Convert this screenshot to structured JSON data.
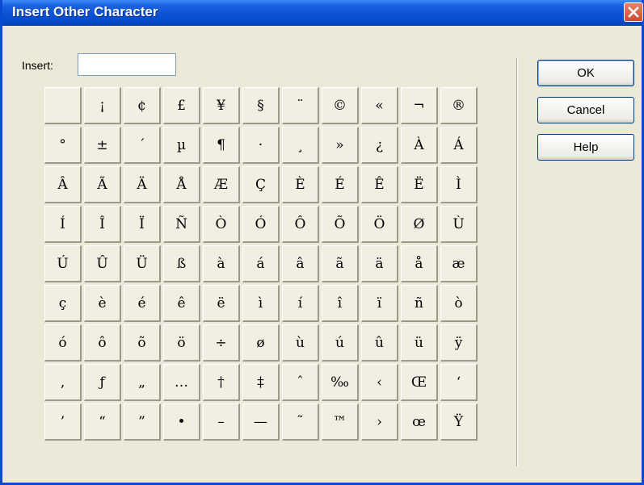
{
  "window": {
    "title": "Insert Other Character"
  },
  "insert": {
    "label": "Insert:",
    "value": ""
  },
  "characters": [
    "",
    "¡",
    "¢",
    "£",
    "¥",
    "§",
    "¨",
    "©",
    "«",
    "¬",
    "®",
    "°",
    "±",
    "´",
    "µ",
    "¶",
    "·",
    "¸",
    "»",
    "¿",
    "À",
    "Á",
    "Â",
    "Ã",
    "Ä",
    "Å",
    "Æ",
    "Ç",
    "È",
    "É",
    "Ê",
    "Ë",
    "Ì",
    "Í",
    "Î",
    "Ï",
    "Ñ",
    "Ò",
    "Ó",
    "Ô",
    "Õ",
    "Ö",
    "Ø",
    "Ù",
    "Ú",
    "Û",
    "Ü",
    "ß",
    "à",
    "á",
    "â",
    "ã",
    "ä",
    "å",
    "æ",
    "ç",
    "è",
    "é",
    "ê",
    "ë",
    "ì",
    "í",
    "î",
    "ï",
    "ñ",
    "ò",
    "ó",
    "ô",
    "õ",
    "ö",
    "÷",
    "ø",
    "ù",
    "ú",
    "û",
    "ü",
    "ÿ",
    "‚",
    "ƒ",
    "„",
    "…",
    "†",
    "‡",
    "ˆ",
    "‰",
    "‹",
    "Œ",
    "‘",
    "’",
    "“",
    "”",
    "•",
    "–",
    "—",
    "˜",
    "™",
    "›",
    "œ",
    "Ÿ"
  ],
  "buttons": {
    "ok": "OK",
    "cancel": "Cancel",
    "help": "Help"
  },
  "colors": {
    "titlebar": "#0a52d6",
    "close_button": "#d04a2d",
    "dialog_background": "#ece9d8"
  },
  "icons": {
    "close": "close-icon"
  }
}
